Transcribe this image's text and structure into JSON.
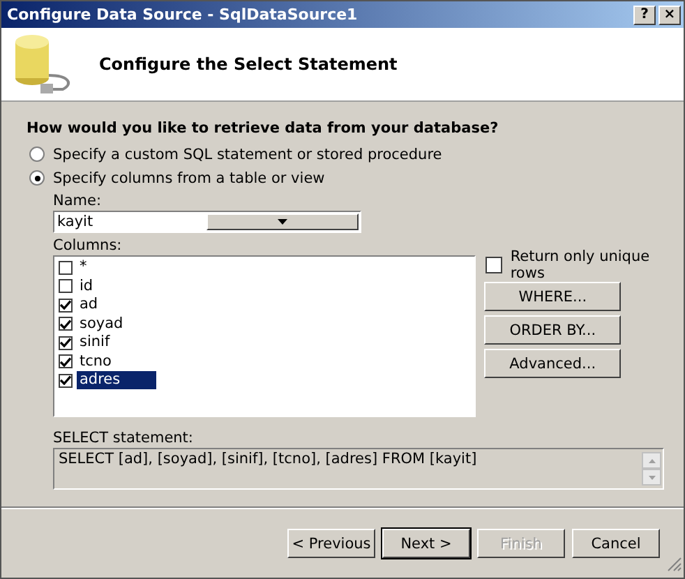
{
  "window": {
    "title": "Configure Data Source - SqlDataSource1",
    "buttons": [
      "?",
      "×"
    ]
  },
  "header": {
    "title": "Configure the Select Statement"
  },
  "question": "How would you like to retrieve data from your database?",
  "options": [
    {
      "label": "Specify a custom SQL statement or stored procedure",
      "selected": false
    },
    {
      "label": "Specify columns from a table or view",
      "selected": true
    }
  ],
  "name_label": "Name:",
  "name_value": "kayit",
  "columns_label": "Columns:",
  "columns": [
    {
      "name": "*",
      "checked": false,
      "selected": false
    },
    {
      "name": "id",
      "checked": false,
      "selected": false
    },
    {
      "name": "ad",
      "checked": true,
      "selected": false
    },
    {
      "name": "soyad",
      "checked": true,
      "selected": false
    },
    {
      "name": "sinif",
      "checked": true,
      "selected": false
    },
    {
      "name": "tcno",
      "checked": true,
      "selected": false
    },
    {
      "name": "adres",
      "checked": true,
      "selected": true
    }
  ],
  "unique_rows": {
    "label": "Return only unique rows",
    "checked": false
  },
  "side_buttons": [
    "WHERE...",
    "ORDER BY...",
    "Advanced..."
  ],
  "statement_label": "SELECT statement:",
  "statement": "SELECT [ad], [soyad], [sinif], [tcno], [adres] FROM [kayit]",
  "footer_buttons": [
    {
      "label": "< Previous",
      "disabled": false,
      "default": false
    },
    {
      "label": "Next >",
      "disabled": false,
      "default": true
    },
    {
      "label": "Finish",
      "disabled": true,
      "default": false
    },
    {
      "label": "Cancel",
      "disabled": false,
      "default": false
    }
  ]
}
